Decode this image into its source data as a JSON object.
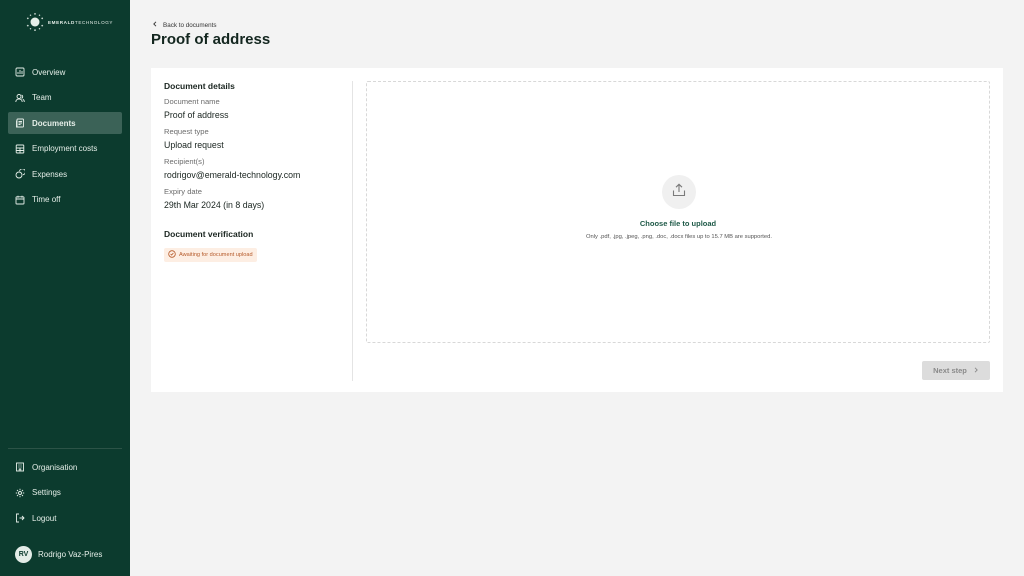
{
  "brand": {
    "name_bold": "EMERALD",
    "name_thin": "TECHNOLOGY"
  },
  "sidebar": {
    "items": [
      {
        "label": "Overview",
        "icon": "chart-icon",
        "active": false
      },
      {
        "label": "Team",
        "icon": "users-icon",
        "active": false
      },
      {
        "label": "Documents",
        "icon": "document-icon",
        "active": true
      },
      {
        "label": "Employment costs",
        "icon": "calculator-icon",
        "active": false
      },
      {
        "label": "Expenses",
        "icon": "coins-icon",
        "active": false
      },
      {
        "label": "Time off",
        "icon": "calendar-icon",
        "active": false
      }
    ],
    "bottom_items": [
      {
        "label": "Organisation",
        "icon": "building-icon"
      },
      {
        "label": "Settings",
        "icon": "gear-icon"
      },
      {
        "label": "Logout",
        "icon": "logout-icon"
      }
    ],
    "user": {
      "initials": "RV",
      "name": "Rodrigo Vaz-Pires"
    }
  },
  "header": {
    "back_label": "Back to documents",
    "title": "Proof of address"
  },
  "details": {
    "title": "Document details",
    "fields": [
      {
        "label": "Document name",
        "value": "Proof of address"
      },
      {
        "label": "Request type",
        "value": "Upload request"
      },
      {
        "label": "Recipient(s)",
        "value": "rodrigov@emerald-technology.com"
      },
      {
        "label": "Expiry date",
        "value": "29th Mar 2024 (in 8 days)"
      }
    ],
    "verification_title": "Document verification",
    "status_badge": "Awaiting for document upload"
  },
  "upload": {
    "cta": "Choose file to upload",
    "hint": "Only .pdf, .jpg, .jpeg, .png, .doc, .docx files up to 15.7 MB are supported."
  },
  "actions": {
    "next_label": "Next step"
  },
  "colors": {
    "sidebar_bg": "#0c3b2e",
    "sidebar_active": "#3b6257",
    "accent": "#1f5a48",
    "badge_bg": "#fdeee3",
    "badge_text": "#b55a2a",
    "page_bg": "#f3f3f3"
  }
}
